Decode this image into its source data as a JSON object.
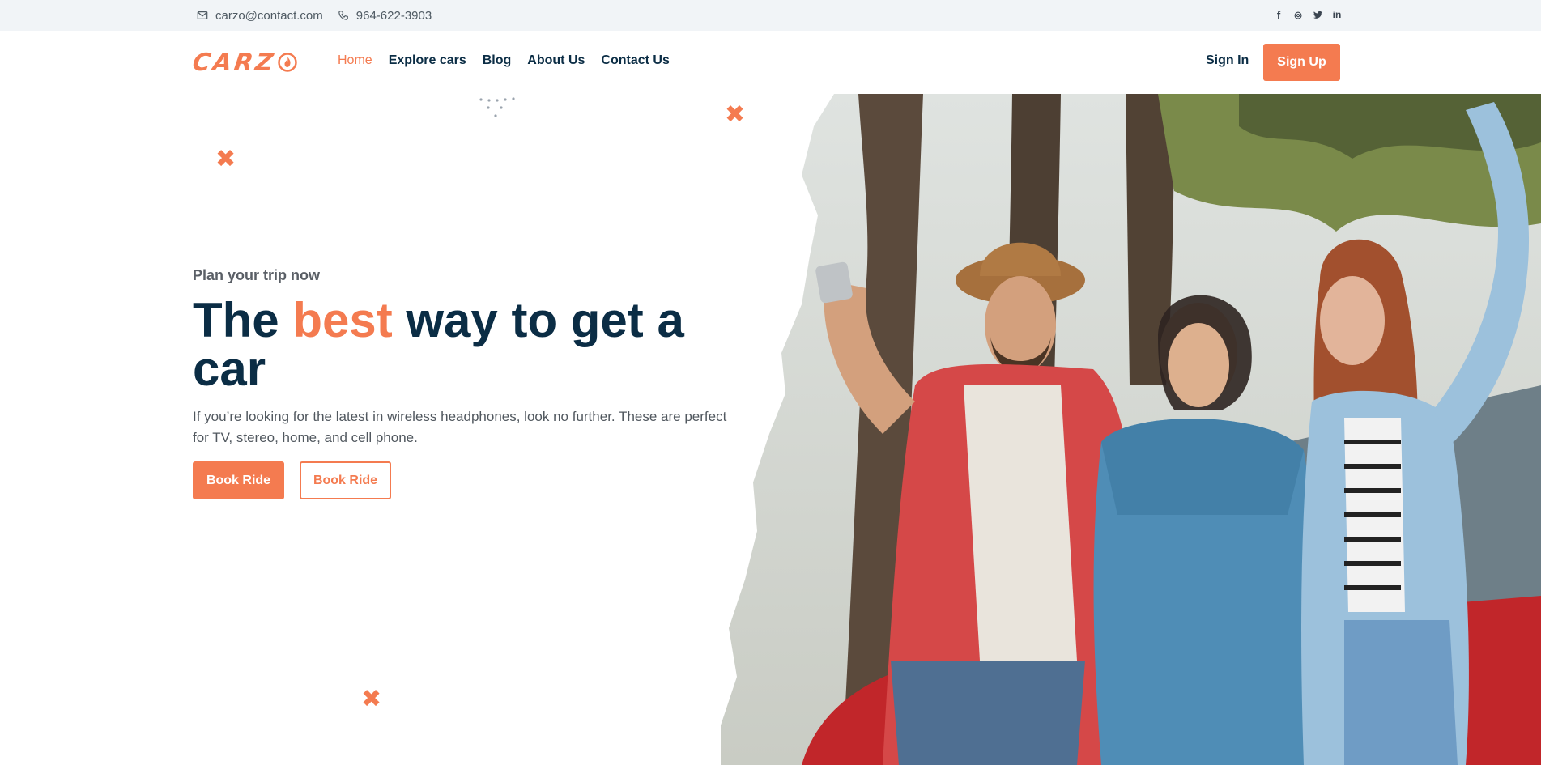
{
  "topbar": {
    "email": "carzo@contact.com",
    "phone": "964-622-3903",
    "social": [
      {
        "icon": "facebook-icon",
        "glyph": "f"
      },
      {
        "icon": "instagram-icon",
        "glyph": "◎"
      },
      {
        "icon": "twitter-icon",
        "glyph": "🐦"
      },
      {
        "icon": "linkedin-icon",
        "glyph": "in"
      }
    ]
  },
  "nav": {
    "logo_text": "CARZ",
    "items": [
      "Home",
      "Explore cars",
      "Blog",
      "About Us",
      "Contact Us"
    ],
    "active_index": 0,
    "signin_label": "Sign In",
    "signup_label": "Sign Up"
  },
  "hero": {
    "eyebrow": "Plan your trip now",
    "title_before": "The ",
    "title_accent": "best",
    "title_after": " way to get a car",
    "description": "If you’re looking for the latest in wireless headphones, look no further. These are perfect for TV, stereo, home, and cell phone.",
    "primary_button": "Book Ride",
    "secondary_button": "Book Ride"
  },
  "colors": {
    "accent": "#f47b50",
    "navy": "#0b2d45",
    "topbar_bg": "#f1f4f7"
  }
}
